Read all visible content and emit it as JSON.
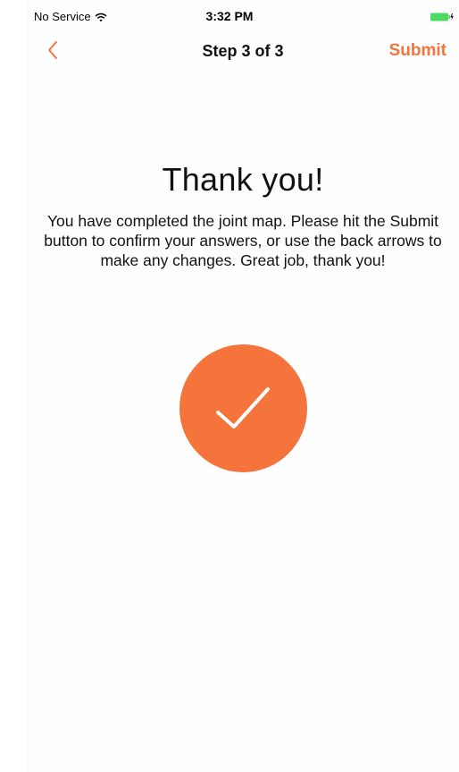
{
  "status_bar": {
    "carrier": "No Service",
    "time": "3:32 PM",
    "wifi_icon": "wifi-icon",
    "battery_icon": "battery-charging-icon",
    "battery_color": "#4cd964"
  },
  "nav": {
    "back_icon": "chevron-left-icon",
    "title": "Step 3 of 3",
    "submit_label": "Submit"
  },
  "content": {
    "heading": "Thank you!",
    "message": "You have completed the joint map. Please hit the Submit button to confirm your answers, or use the back arrows to make any changes. Great job, thank you!",
    "check_icon": "checkmark-icon"
  },
  "colors": {
    "accent": "#f4743c",
    "text": "#111111",
    "background": "#ffffff"
  }
}
